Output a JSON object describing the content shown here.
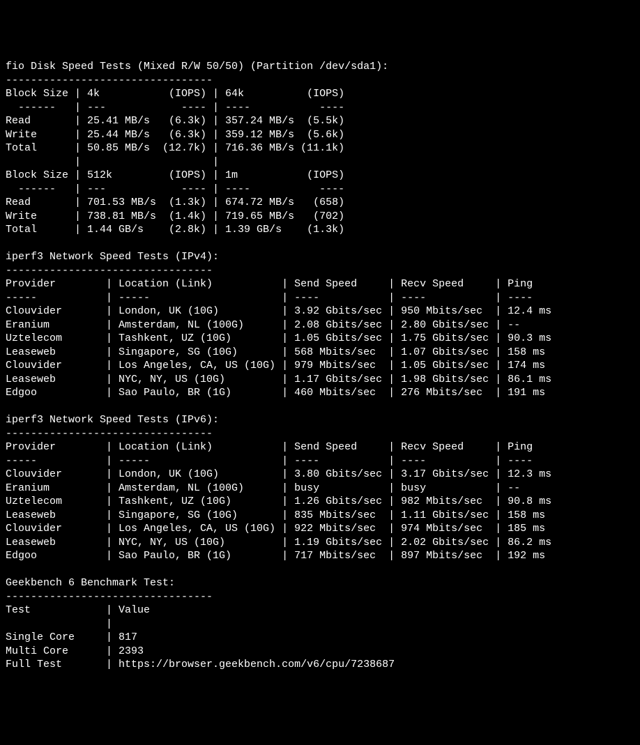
{
  "fio": {
    "title": "fio Disk Speed Tests (Mixed R/W 50/50) (Partition /dev/sda1):",
    "dashes": "---------------------------------",
    "hdr_bs": "Block Size",
    "hdr_4k": "4k",
    "hdr_64k": "64k",
    "hdr_512k": "512k",
    "hdr_1m": "1m",
    "hdr_iops": "(IOPS)",
    "sub_a": "  ------",
    "sub_b": "---",
    "sub_c": "----",
    "rows1": {
      "read": {
        "label": "Read",
        "a": "25.41 MB/s",
        "ai": "(6.3k)",
        "b": "357.24 MB/s",
        "bi": "(5.5k)"
      },
      "write": {
        "label": "Write",
        "a": "25.44 MB/s",
        "ai": "(6.3k)",
        "b": "359.12 MB/s",
        "bi": "(5.6k)"
      },
      "total": {
        "label": "Total",
        "a": "50.85 MB/s",
        "ai": "(12.7k)",
        "b": "716.36 MB/s",
        "bi": "(11.1k)"
      }
    },
    "rows2": {
      "read": {
        "label": "Read",
        "a": "701.53 MB/s",
        "ai": "(1.3k)",
        "b": "674.72 MB/s",
        "bi": "(658)"
      },
      "write": {
        "label": "Write",
        "a": "738.81 MB/s",
        "ai": "(1.4k)",
        "b": "719.65 MB/s",
        "bi": "(702)"
      },
      "total": {
        "label": "Total",
        "a": "1.44 GB/s",
        "ai": "(2.8k)",
        "b": "1.39 GB/s",
        "bi": "(1.3k)"
      }
    }
  },
  "ipv4": {
    "title": "iperf3 Network Speed Tests (IPv4):",
    "dashes": "---------------------------------",
    "hdr": {
      "prov": "Provider",
      "loc": "Location (Link)",
      "send": "Send Speed",
      "recv": "Recv Speed",
      "ping": "Ping"
    },
    "sub": {
      "prov": "-----",
      "loc": "-----",
      "send": "----",
      "recv": "----",
      "ping": "----"
    },
    "rows": [
      {
        "prov": "Clouvider",
        "loc": "London, UK (10G)",
        "send": "3.92 Gbits/sec",
        "recv": "950 Mbits/sec",
        "ping": "12.4 ms"
      },
      {
        "prov": "Eranium",
        "loc": "Amsterdam, NL (100G)",
        "send": "2.08 Gbits/sec",
        "recv": "2.80 Gbits/sec",
        "ping": "--"
      },
      {
        "prov": "Uztelecom",
        "loc": "Tashkent, UZ (10G)",
        "send": "1.05 Gbits/sec",
        "recv": "1.75 Gbits/sec",
        "ping": "90.3 ms"
      },
      {
        "prov": "Leaseweb",
        "loc": "Singapore, SG (10G)",
        "send": "568 Mbits/sec",
        "recv": "1.07 Gbits/sec",
        "ping": "158 ms"
      },
      {
        "prov": "Clouvider",
        "loc": "Los Angeles, CA, US (10G)",
        "send": "979 Mbits/sec",
        "recv": "1.05 Gbits/sec",
        "ping": "174 ms"
      },
      {
        "prov": "Leaseweb",
        "loc": "NYC, NY, US (10G)",
        "send": "1.17 Gbits/sec",
        "recv": "1.98 Gbits/sec",
        "ping": "86.1 ms"
      },
      {
        "prov": "Edgoo",
        "loc": "Sao Paulo, BR (1G)",
        "send": "460 Mbits/sec",
        "recv": "276 Mbits/sec",
        "ping": "191 ms"
      }
    ]
  },
  "ipv6": {
    "title": "iperf3 Network Speed Tests (IPv6):",
    "dashes": "---------------------------------",
    "hdr": {
      "prov": "Provider",
      "loc": "Location (Link)",
      "send": "Send Speed",
      "recv": "Recv Speed",
      "ping": "Ping"
    },
    "sub": {
      "prov": "-----",
      "loc": "-----",
      "send": "----",
      "recv": "----",
      "ping": "----"
    },
    "rows": [
      {
        "prov": "Clouvider",
        "loc": "London, UK (10G)",
        "send": "3.80 Gbits/sec",
        "recv": "3.17 Gbits/sec",
        "ping": "12.3 ms"
      },
      {
        "prov": "Eranium",
        "loc": "Amsterdam, NL (100G)",
        "send": "busy",
        "recv": "busy",
        "ping": "--"
      },
      {
        "prov": "Uztelecom",
        "loc": "Tashkent, UZ (10G)",
        "send": "1.26 Gbits/sec",
        "recv": "982 Mbits/sec",
        "ping": "90.8 ms"
      },
      {
        "prov": "Leaseweb",
        "loc": "Singapore, SG (10G)",
        "send": "835 Mbits/sec",
        "recv": "1.11 Gbits/sec",
        "ping": "158 ms"
      },
      {
        "prov": "Clouvider",
        "loc": "Los Angeles, CA, US (10G)",
        "send": "922 Mbits/sec",
        "recv": "974 Mbits/sec",
        "ping": "185 ms"
      },
      {
        "prov": "Leaseweb",
        "loc": "NYC, NY, US (10G)",
        "send": "1.19 Gbits/sec",
        "recv": "2.02 Gbits/sec",
        "ping": "86.2 ms"
      },
      {
        "prov": "Edgoo",
        "loc": "Sao Paulo, BR (1G)",
        "send": "717 Mbits/sec",
        "recv": "897 Mbits/sec",
        "ping": "192 ms"
      }
    ]
  },
  "gb": {
    "title": "Geekbench 6 Benchmark Test:",
    "dashes": "---------------------------------",
    "hdr": {
      "test": "Test",
      "value": "Value"
    },
    "rows": {
      "single": {
        "label": "Single Core",
        "value": "817"
      },
      "multi": {
        "label": "Multi Core",
        "value": "2393"
      },
      "full": {
        "label": "Full Test",
        "value": "https://browser.geekbench.com/v6/cpu/7238687"
      }
    }
  }
}
